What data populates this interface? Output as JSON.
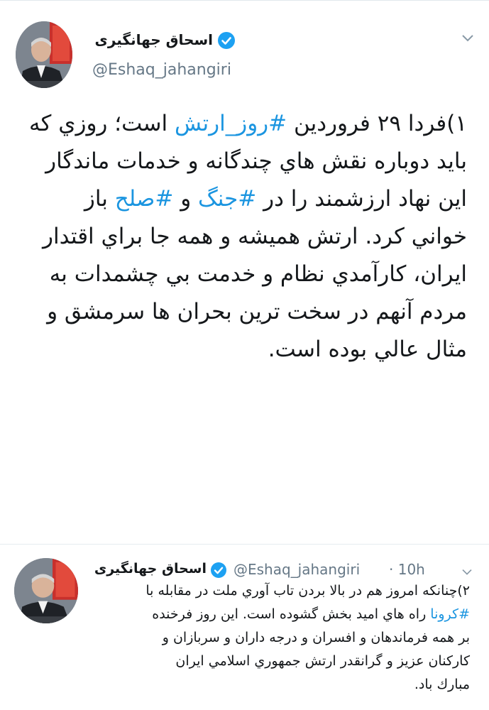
{
  "tweet1": {
    "author_name": "اسحاق جهانگیری",
    "handle": "@Eshaq_jahangiri",
    "avatar_icon": "portrait-avatar",
    "verified_icon": "verified-badge-icon",
    "menu_icon": "chevron-down-icon",
    "lines": [
      {
        "pre": "۱)فردا ۲۹ فروردين ",
        "tag": "#روز_ارتش",
        "post": " است؛ روزي كه"
      },
      {
        "pre": "بايد دوباره نقش هاي چندگانه و خدمات ماندگار",
        "tag": "",
        "post": ""
      },
      {
        "pre": "اين نهاد ارزشمند را در ",
        "tag": "#جنگ",
        "mid": " و ",
        "tag2": "#صلح",
        "post": " باز"
      },
      {
        "pre": "خواني كرد. ارتش هميشه و همه جا براي اقتدار",
        "tag": "",
        "post": ""
      },
      {
        "pre": "ايران، كارآمدي نظام و خدمت بي چشمدات به",
        "tag": "",
        "post": ""
      },
      {
        "pre": "مردم آنهم در سخت ترين بحران ها سرمشق و",
        "tag": "",
        "post": ""
      },
      {
        "pre": "مثال عالي بوده است.",
        "tag": "",
        "post": ""
      }
    ]
  },
  "tweet2": {
    "author_name": "اسحاق جهانگیری",
    "handle": "@Eshaq_jahangiri",
    "time": "· 10h",
    "lines": [
      {
        "pre": "۲)چنانكه امروز هم در بالا بردن تاب آوري ملت در مقابله با",
        "tag": "",
        "post": ""
      },
      {
        "pre": "",
        "tag": "#كرونا",
        "post": " راه هاي اميد بخش گشوده است. اين روز فرخنده"
      },
      {
        "pre": "بر همه فرماندهان و افسران و درجه داران و سربازان و",
        "tag": "",
        "post": ""
      },
      {
        "pre": "كاركنان عزيز و گرانقدر ارتش جمهوري اسلامي ايران",
        "tag": "",
        "post": ""
      },
      {
        "pre": "مبارك باد.",
        "tag": "",
        "post": ""
      }
    ]
  },
  "colors": {
    "hashtag": "#1b95e0",
    "verified": "#1da1f2",
    "muted": "#657786",
    "text": "#14171a"
  }
}
